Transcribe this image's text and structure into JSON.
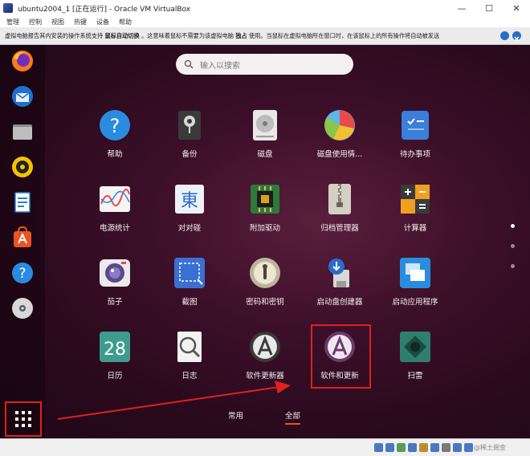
{
  "window": {
    "title": "ubuntu2004_1 [正在运行] - Oracle VM VirtualBox",
    "controls": {
      "minimize": "—",
      "maximize": "☐",
      "close": "✕"
    }
  },
  "menubar": [
    "管理",
    "控制",
    "视图",
    "热键",
    "设备",
    "帮助"
  ],
  "notice": {
    "text_a": "虚拟电脑报告其内安装的操作系统支持",
    "text_bold": "鼠标自动切换",
    "text_b": "。这意味着鼠标不需要为该虚拟电脑",
    "text_bold2": "独占",
    "text_c": "使用。当鼠标在虚拟电脑所在窗口时，在该鼠标上的所有操作将自动被发送"
  },
  "dock": {
    "items": [
      "firefox-icon",
      "thunderbird-icon",
      "files-icon",
      "rhythmbox-icon",
      "writer-icon",
      "software-icon",
      "help-icon",
      "disc-icon"
    ],
    "show_apps": "show-applications-icon"
  },
  "search": {
    "placeholder": "输入以搜索"
  },
  "apps": [
    {
      "label": "帮助",
      "icon": "help-icon"
    },
    {
      "label": "备份",
      "icon": "backup-icon"
    },
    {
      "label": "磁盘",
      "icon": "disks-icon"
    },
    {
      "label": "磁盘使用情...",
      "icon": "disk-usage-icon"
    },
    {
      "label": "待办事项",
      "icon": "todo-icon"
    },
    {
      "label": "电源统计",
      "icon": "power-stats-icon"
    },
    {
      "label": "对对碰",
      "icon": "swell-foop-icon"
    },
    {
      "label": "附加驱动",
      "icon": "additional-drivers-icon"
    },
    {
      "label": "归档管理器",
      "icon": "archive-manager-icon"
    },
    {
      "label": "计算器",
      "icon": "calculator-icon"
    },
    {
      "label": "茄子",
      "icon": "cheese-icon"
    },
    {
      "label": "截图",
      "icon": "screenshot-icon"
    },
    {
      "label": "密码和密钥",
      "icon": "passwords-keys-icon"
    },
    {
      "label": "启动盘创建器",
      "icon": "startup-disk-creator-icon"
    },
    {
      "label": "启动应用程序",
      "icon": "startup-applications-icon"
    },
    {
      "label": "日历",
      "icon": "calendar-icon",
      "glyph": "28"
    },
    {
      "label": "日志",
      "icon": "logs-icon"
    },
    {
      "label": "软件更新器",
      "icon": "software-updater-icon"
    },
    {
      "label": "软件和更新",
      "icon": "software-updates-icon"
    },
    {
      "label": "扫雷",
      "icon": "mines-icon"
    }
  ],
  "tabs": {
    "frequent": "常用",
    "all": "全部"
  },
  "status": {
    "watermark": "@稀土掘金"
  },
  "colors": {
    "accent": "#e95420",
    "highlight": "#e02020",
    "wallpaper": "#3c0f29"
  }
}
